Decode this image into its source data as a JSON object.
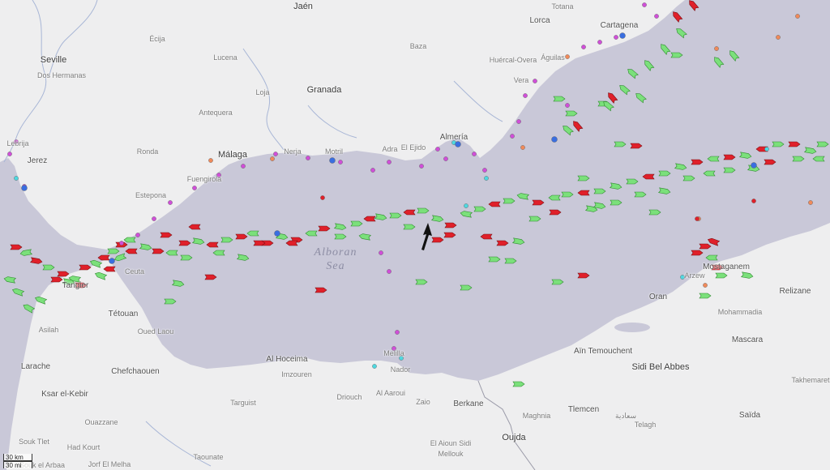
{
  "map": {
    "sea_name_line1": "Alboran",
    "sea_name_line2": "Sea",
    "colors": {
      "land": "#eeeeef",
      "sea": "#c9c8d8",
      "cargo": "#7be07b",
      "tanker": "#e0202a",
      "passenger": "#3a6ee0",
      "pleasure": "#d04fd8",
      "tug": "#4fd8e0",
      "fishing": "#f08a5a"
    },
    "cities": [
      {
        "id": "jaen",
        "name": "Jaén"
      },
      {
        "id": "totana",
        "name": "Totana"
      },
      {
        "id": "ecija",
        "name": "Écija"
      },
      {
        "id": "lorca",
        "name": "Lorca"
      },
      {
        "id": "cartagena",
        "name": "Cartagena"
      },
      {
        "id": "seville",
        "name": "Seville"
      },
      {
        "id": "dos-hermanas",
        "name": "Dos Hermanas"
      },
      {
        "id": "baza",
        "name": "Baza"
      },
      {
        "id": "lucena",
        "name": "Lucena"
      },
      {
        "id": "huercal-overa",
        "name": "Huércal-Overa"
      },
      {
        "id": "aguilas",
        "name": "Águilas"
      },
      {
        "id": "loja",
        "name": "Loja"
      },
      {
        "id": "granada",
        "name": "Granada"
      },
      {
        "id": "vera",
        "name": "Vera"
      },
      {
        "id": "antequera",
        "name": "Antequera"
      },
      {
        "id": "lebrija",
        "name": "Lebrija"
      },
      {
        "id": "almeria",
        "name": "Almería"
      },
      {
        "id": "ronda",
        "name": "Ronda"
      },
      {
        "id": "nerja",
        "name": "Nerja"
      },
      {
        "id": "motril",
        "name": "Motril"
      },
      {
        "id": "adra",
        "name": "Adra"
      },
      {
        "id": "el-ejido",
        "name": "El Ejido"
      },
      {
        "id": "malaga",
        "name": "Málaga"
      },
      {
        "id": "jerez",
        "name": "Jerez"
      },
      {
        "id": "fuengirola",
        "name": "Fuengirola"
      },
      {
        "id": "estepona",
        "name": "Estepona"
      },
      {
        "id": "ceuta",
        "name": "Ceuta"
      },
      {
        "id": "tangier",
        "name": "Tangier"
      },
      {
        "id": "mostaganem",
        "name": "Mostaganem"
      },
      {
        "id": "arzew",
        "name": "Arzew"
      },
      {
        "id": "tetouan",
        "name": "Tétouan"
      },
      {
        "id": "relizane",
        "name": "Relizane"
      },
      {
        "id": "oran",
        "name": "Oran"
      },
      {
        "id": "mohammadia",
        "name": "Mohammadia"
      },
      {
        "id": "asilah",
        "name": "Asilah"
      },
      {
        "id": "oued-laou",
        "name": "Oued Laou"
      },
      {
        "id": "mascara",
        "name": "Mascara"
      },
      {
        "id": "al-hoceima",
        "name": "Al Hoceima"
      },
      {
        "id": "melilla",
        "name": "Melilla"
      },
      {
        "id": "ain-temouchent",
        "name": "Aïn Temouchent"
      },
      {
        "id": "larache",
        "name": "Larache"
      },
      {
        "id": "chefchaouen",
        "name": "Chefchaouen"
      },
      {
        "id": "imzouren",
        "name": "Imzouren"
      },
      {
        "id": "nador",
        "name": "Nador"
      },
      {
        "id": "sidi-bel-abbes",
        "name": "Sidi Bel Abbes"
      },
      {
        "id": "takhemaret",
        "name": "Takhemaret"
      },
      {
        "id": "ksar-el-kebir",
        "name": "Ksar el-Kebir"
      },
      {
        "id": "al-aaroui",
        "name": "Al Aaroui"
      },
      {
        "id": "targuist",
        "name": "Targuist"
      },
      {
        "id": "driouch",
        "name": "Driouch"
      },
      {
        "id": "zaio",
        "name": "Zaio"
      },
      {
        "id": "berkane",
        "name": "Berkane"
      },
      {
        "id": "tlemcen",
        "name": "Tlemcen"
      },
      {
        "id": "ouazzane",
        "name": "Ouazzane"
      },
      {
        "id": "maghnia",
        "name": "Maghnia"
      },
      {
        "id": "saida",
        "name": "Saïda"
      },
      {
        "id": "telagh",
        "name": "Telagh"
      },
      {
        "id": "saadia",
        "name": "سعادية"
      },
      {
        "id": "souk-tlet",
        "name": "Souk Tlet"
      },
      {
        "id": "had-kourt",
        "name": "Had Kourt"
      },
      {
        "id": "oujda",
        "name": "Oujda"
      },
      {
        "id": "el-aioun",
        "name": "El Aioun Sidi"
      },
      {
        "id": "mellouk",
        "name": "Mellouk"
      },
      {
        "id": "souk-el-arbaa",
        "name": "Souk el Arbaa"
      },
      {
        "id": "jorf-el-melha",
        "name": "Jorf El Melha"
      },
      {
        "id": "taounate",
        "name": "Taounate"
      }
    ],
    "scale": {
      "metric": "30 km",
      "imperial": "30 mi"
    }
  }
}
